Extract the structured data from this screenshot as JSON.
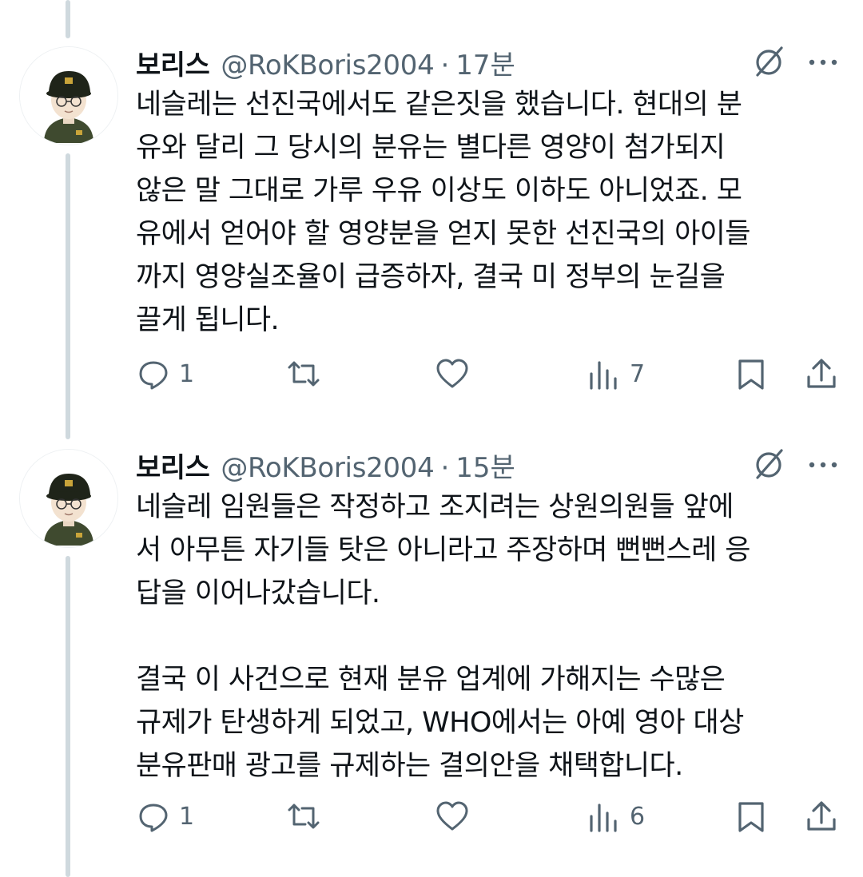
{
  "tweets": [
    {
      "author_name": "보리스",
      "handle": "@RoKBoris2004",
      "separator": "·",
      "time": "17분",
      "text": "네슬레는 선진국에서도 같은짓을 했습니다. 현대의 분\n유와 달리 그 당시의 분유는 별다른 영양이 첨가되지\n않은 말 그대로 가루 우유 이상도 이하도 아니었죠. 모\n유에서 얻어야 할 영양분을 얻지 못한 선진국의 아이들\n까지 영양실조율이 급증하자, 결국 미 정부의 눈길을\n끌게 됩니다.",
      "reply_count": "1",
      "view_count": "7"
    },
    {
      "author_name": "보리스",
      "handle": "@RoKBoris2004",
      "separator": "·",
      "time": "15분",
      "text": "네슬레 임원들은 작정하고 조지려는 상원의원들 앞에\n서 아무튼 자기들 탓은 아니라고 주장하며 뻔뻔스레 응\n답을 이어나갔습니다.\n\n결국 이 사건으로 현재 분유 업계에 가해지는 수많은\n규제가 탄생하게 되었고, WHO에서는 아예 영아 대상\n분유판매 광고를 규제하는 결의안을 채택합니다.",
      "reply_count": "1",
      "view_count": "6"
    }
  ],
  "icons": {
    "reply": "reply-icon",
    "retweet": "retweet-icon",
    "like": "heart-icon",
    "views": "views-icon",
    "bookmark": "bookmark-icon",
    "share": "share-icon",
    "grok": "grok-icon",
    "more": "more-icon",
    "avatar": "avatar-image"
  },
  "colors": {
    "text": "#0f1419",
    "secondary": "#536471",
    "thread_line": "#cfd9de",
    "background": "#ffffff"
  }
}
